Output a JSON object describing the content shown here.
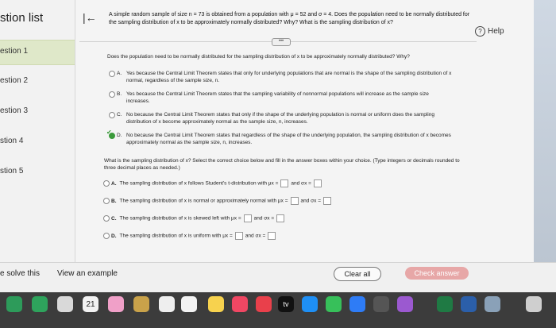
{
  "sidebar": {
    "title": "stion list",
    "items": [
      {
        "label": "estion 1"
      },
      {
        "label": "estion 2"
      },
      {
        "label": "estion 3"
      },
      {
        "label": "stion 4"
      },
      {
        "label": "stion 5"
      }
    ]
  },
  "header": {
    "help_label": "Help"
  },
  "question": {
    "text": "A simple random sample of size n = 73 is obtained from a population with μ = 52 and σ = 4. Does the population need to be normally distributed for the sampling distribution of x to be approximately normally distributed? Why? What is the sampling distribution of x?",
    "prompt": "Does the population need to be normally distributed for the sampling distribution of x to be approximately normally distributed? Why?",
    "options": [
      {
        "letter": "A.",
        "text": "Yes because the Central Limit Theorem states that only for underlying populations that are normal is the shape of the sampling distribution of x normal, regardless of the sample size, n."
      },
      {
        "letter": "B.",
        "text": "Yes because the Central Limit Theorem states that the sampling variability of nonnormal populations will increase as the sample size increases."
      },
      {
        "letter": "C.",
        "text": "No because the Central Limit Theorem states that only if the shape of the underlying population is normal or uniform does the sampling distribution of x become approximately normal as the sample size, n, increases."
      },
      {
        "letter": "D.",
        "text": "No because the Central Limit Theorem states that regardless of the shape of the underlying population, the sampling distribution of x becomes approximately normal as the sample size, n, increases."
      }
    ],
    "prompt2": "What is the sampling distribution of x? Select the correct choice below and fill in the answer boxes within your choice. (Type integers or decimals rounded to three decimal places as needed.)",
    "options2": [
      {
        "letter": "A.",
        "text": "The sampling distribution of x follows Student's t-distribution with μx =",
        "and": "and σx ="
      },
      {
        "letter": "B.",
        "text": "The sampling distribution of x is normal or approximately normal with μx =",
        "and": "and σx ="
      },
      {
        "letter": "C.",
        "text": "The sampling distribution of x is skewed left with μx =",
        "and": "and σx ="
      },
      {
        "letter": "D.",
        "text": "The sampling distribution of x is uniform with μx =",
        "and": "and σx ="
      }
    ]
  },
  "footer": {
    "solve_label": "e solve this",
    "example_label": "View an example",
    "clear_label": "Clear all",
    "check_label": "Check answer"
  },
  "dock": {
    "calendar_day": "21",
    "tv_label": "tv"
  },
  "colors": {
    "check_button": "#e7a7a7",
    "active_question": "#dfe8c9",
    "selected_check": "#3a9a3a"
  }
}
